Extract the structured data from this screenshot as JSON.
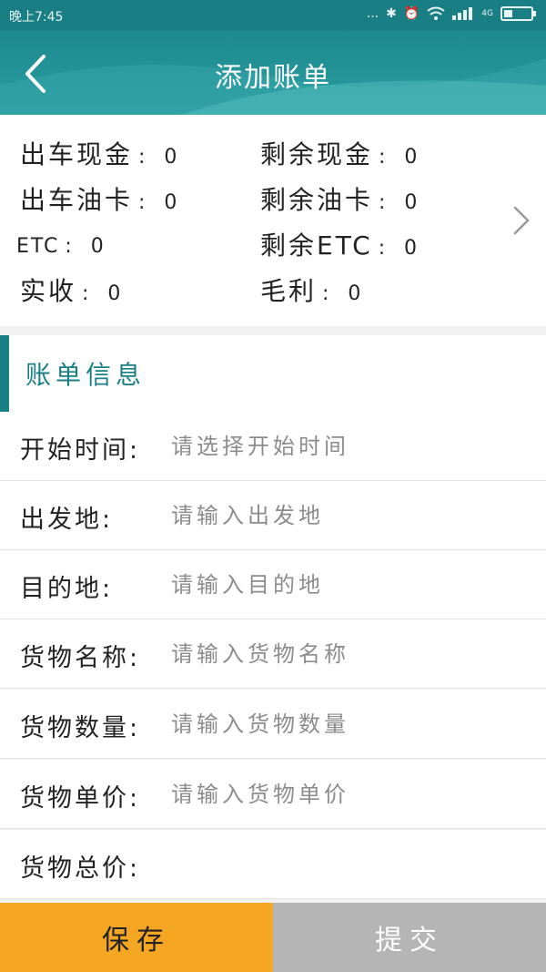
{
  "status_bar": {
    "time": "晚上7:45",
    "dots": "...",
    "signal": "4G"
  },
  "header": {
    "title": "添加账单"
  },
  "summary": [
    {
      "label": "出车现金",
      "value": "0"
    },
    {
      "label": "剩余现金",
      "value": "0"
    },
    {
      "label": "出车油卡",
      "value": "0"
    },
    {
      "label": "剩余油卡",
      "value": "0"
    },
    {
      "label": "ETC",
      "value": "0"
    },
    {
      "label": "剩余ETC",
      "value": "0"
    },
    {
      "label": "实收",
      "value": "0"
    },
    {
      "label": "毛利",
      "value": "0"
    }
  ],
  "section": {
    "title": "账单信息"
  },
  "form": [
    {
      "label": "开始时间:",
      "placeholder": "请选择开始时间",
      "value": ""
    },
    {
      "label": "出发地:",
      "placeholder": "请输入出发地",
      "value": ""
    },
    {
      "label": "目的地:",
      "placeholder": "请输入目的地",
      "value": ""
    },
    {
      "label": "货物名称:",
      "placeholder": "请输入货物名称",
      "value": ""
    },
    {
      "label": "货物数量:",
      "placeholder": "请输入货物数量",
      "value": ""
    },
    {
      "label": "货物单价:",
      "placeholder": "请输入货物单价",
      "value": ""
    },
    {
      "label": "货物总价:",
      "placeholder": "",
      "value": ""
    }
  ],
  "buttons": {
    "save": "保存",
    "submit": "提交"
  },
  "colors": {
    "primary": "#1a7f84",
    "save": "#f5a623",
    "submit": "#b5b5b5"
  }
}
